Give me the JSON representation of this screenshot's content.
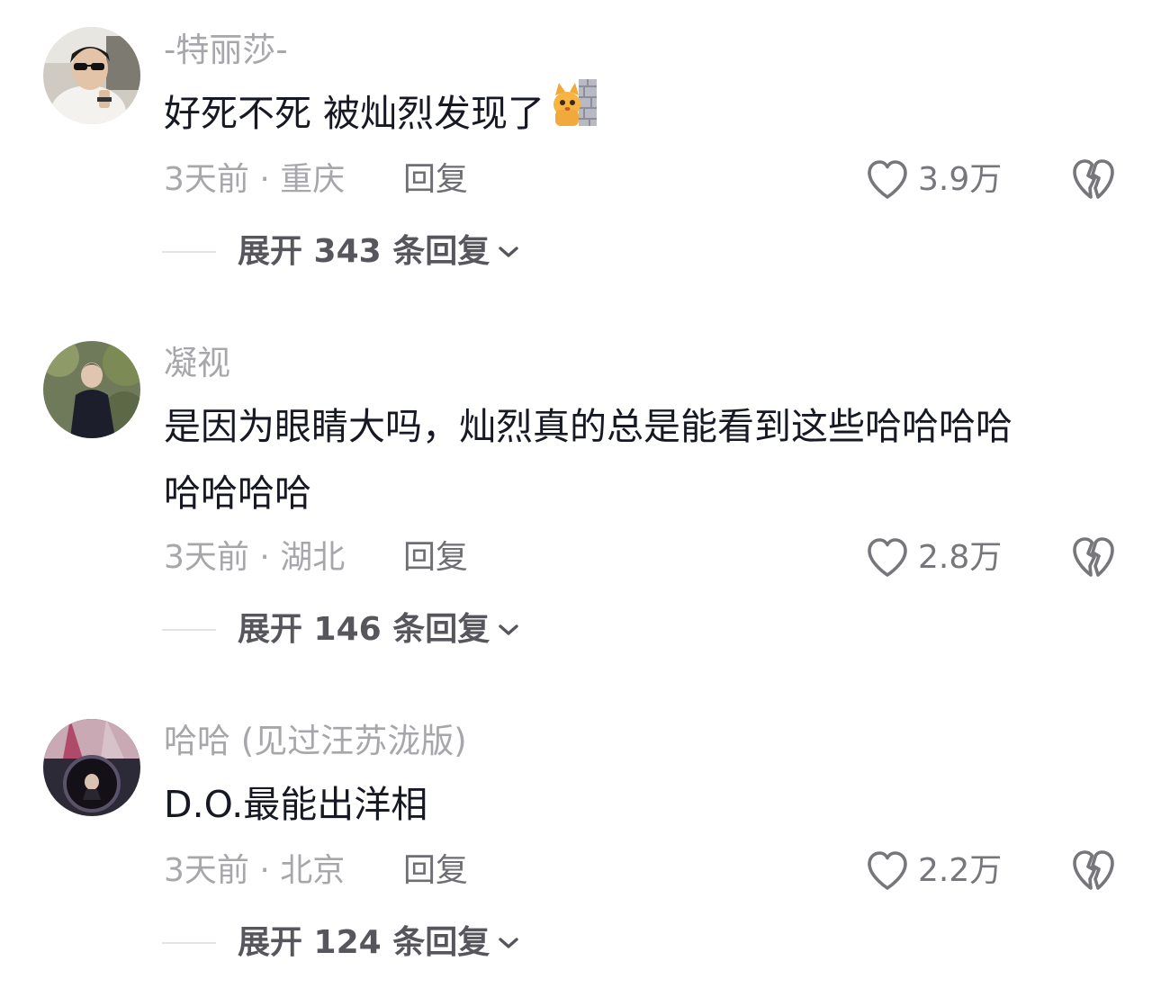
{
  "comments": [
    {
      "username": "-特丽莎-",
      "lines": [
        "好死不死 被灿烈发现了"
      ],
      "emoji": "cat-peeking-emoji",
      "meta": "3天前 · 重庆",
      "reply_label": "回复",
      "likes": "3.9万",
      "expand_label": "展开 343 条回复"
    },
    {
      "username": "凝视",
      "lines": [
        "是因为眼睛大吗，灿烈真的总是能看到这些哈哈哈哈",
        "哈哈哈哈"
      ],
      "meta": "3天前 · 湖北",
      "reply_label": "回复",
      "likes": "2.8万",
      "expand_label": "展开 146 条回复"
    },
    {
      "username": "哈哈 (见过汪苏泷版)",
      "lines": [
        "D.O.最能出洋相"
      ],
      "meta": "3天前 · 北京",
      "reply_label": "回复",
      "likes": "2.2万",
      "expand_label": "展开 124 条回复"
    }
  ],
  "icons": {
    "like": "heart-outline-icon",
    "dislike": "broken-heart-icon",
    "expand": "chevron-down-icon"
  },
  "colors": {
    "background": "#ffffff",
    "text_primary": "#161823",
    "text_secondary": "#a7a7ab",
    "icon_gray": "#76767b"
  }
}
